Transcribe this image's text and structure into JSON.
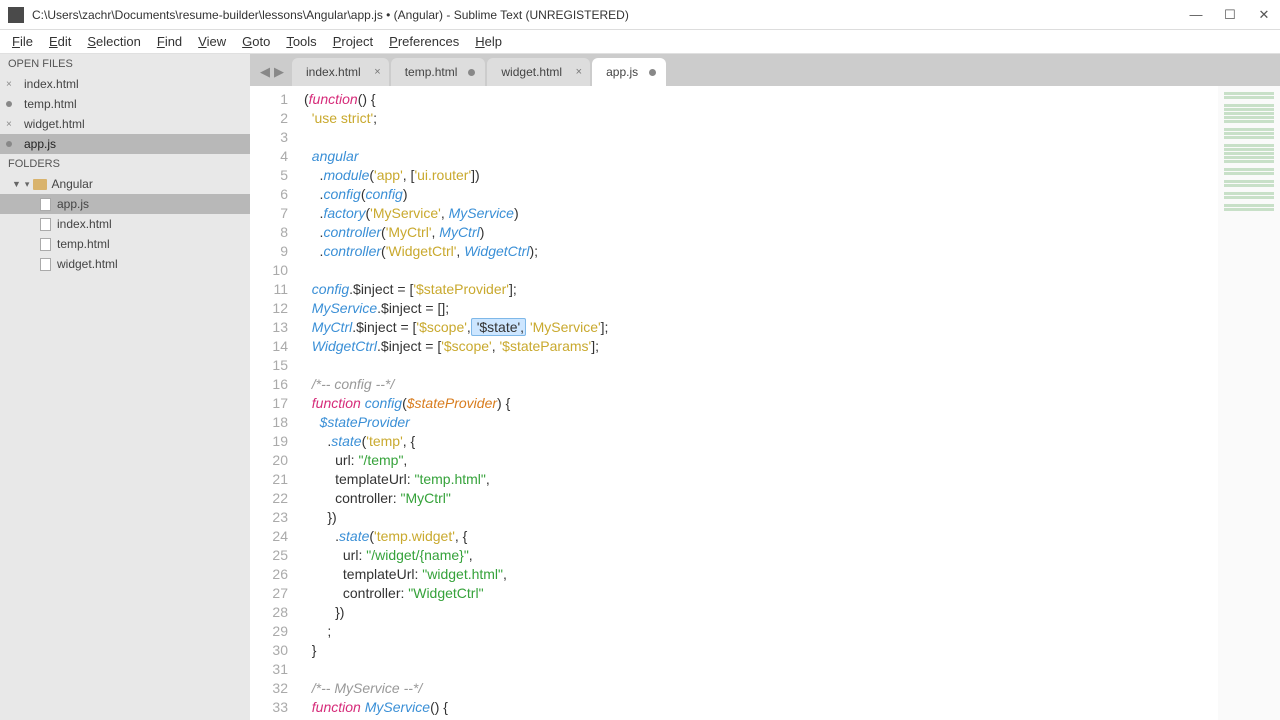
{
  "window": {
    "title": "C:\\Users\\zachr\\Documents\\resume-builder\\lessons\\Angular\\app.js • (Angular) - Sublime Text (UNREGISTERED)"
  },
  "menu": [
    "File",
    "Edit",
    "Selection",
    "Find",
    "View",
    "Goto",
    "Tools",
    "Project",
    "Preferences",
    "Help"
  ],
  "sidebar": {
    "open_files_label": "OPEN FILES",
    "open_files": [
      {
        "name": "index.html",
        "dirty": false
      },
      {
        "name": "temp.html",
        "dirty": true
      },
      {
        "name": "widget.html",
        "dirty": false
      },
      {
        "name": "app.js",
        "dirty": true,
        "active": true
      }
    ],
    "folders_label": "FOLDERS",
    "folder_name": "Angular",
    "files": [
      {
        "name": "app.js",
        "active": true
      },
      {
        "name": "index.html"
      },
      {
        "name": "temp.html"
      },
      {
        "name": "widget.html"
      }
    ]
  },
  "tabs": [
    {
      "label": "index.html",
      "dirty": false
    },
    {
      "label": "temp.html",
      "dirty": true
    },
    {
      "label": "widget.html",
      "dirty": false
    },
    {
      "label": "app.js",
      "dirty": true,
      "active": true
    }
  ],
  "code": {
    "lines": [
      [
        {
          "t": "("
        },
        {
          "t": "function",
          "c": "kw"
        },
        {
          "t": "() {"
        }
      ],
      [
        {
          "t": "  "
        },
        {
          "t": "'use strict'",
          "c": "str2"
        },
        {
          "t": ";"
        }
      ],
      [
        {
          "t": ""
        }
      ],
      [
        {
          "t": "  "
        },
        {
          "t": "angular",
          "c": "ent"
        }
      ],
      [
        {
          "t": "    ."
        },
        {
          "t": "module",
          "c": "fn"
        },
        {
          "t": "("
        },
        {
          "t": "'app'",
          "c": "str2"
        },
        {
          "t": ", ["
        },
        {
          "t": "'ui.router'",
          "c": "str2"
        },
        {
          "t": "])"
        }
      ],
      [
        {
          "t": "    ."
        },
        {
          "t": "config",
          "c": "fn"
        },
        {
          "t": "("
        },
        {
          "t": "config",
          "c": "ent"
        },
        {
          "t": ")"
        }
      ],
      [
        {
          "t": "    ."
        },
        {
          "t": "factory",
          "c": "fn"
        },
        {
          "t": "("
        },
        {
          "t": "'MyService'",
          "c": "str2"
        },
        {
          "t": ", "
        },
        {
          "t": "MyService",
          "c": "ent"
        },
        {
          "t": ")"
        }
      ],
      [
        {
          "t": "    ."
        },
        {
          "t": "controller",
          "c": "fn"
        },
        {
          "t": "("
        },
        {
          "t": "'MyCtrl'",
          "c": "str2"
        },
        {
          "t": ", "
        },
        {
          "t": "MyCtrl",
          "c": "ent"
        },
        {
          "t": ")"
        }
      ],
      [
        {
          "t": "    ."
        },
        {
          "t": "controller",
          "c": "fn"
        },
        {
          "t": "("
        },
        {
          "t": "'WidgetCtrl'",
          "c": "str2"
        },
        {
          "t": ", "
        },
        {
          "t": "WidgetCtrl",
          "c": "ent"
        },
        {
          "t": ");"
        }
      ],
      [
        {
          "t": ""
        }
      ],
      [
        {
          "t": "  "
        },
        {
          "t": "config",
          "c": "ent"
        },
        {
          "t": ".$inject = ["
        },
        {
          "t": "'$stateProvider'",
          "c": "str2"
        },
        {
          "t": "];"
        }
      ],
      [
        {
          "t": "  "
        },
        {
          "t": "MyService",
          "c": "ent"
        },
        {
          "t": ".$inject = [];"
        }
      ],
      [
        {
          "t": "  "
        },
        {
          "t": "MyCtrl",
          "c": "ent"
        },
        {
          "t": ".$inject = ["
        },
        {
          "t": "'$scope'",
          "c": "str2"
        },
        {
          "t": ","
        },
        {
          "t": " '$state',",
          "c": "sel"
        },
        {
          "t": " "
        },
        {
          "t": "'MyService'",
          "c": "str2"
        },
        {
          "t": "];"
        }
      ],
      [
        {
          "t": "  "
        },
        {
          "t": "WidgetCtrl",
          "c": "ent"
        },
        {
          "t": ".$inject = ["
        },
        {
          "t": "'$scope'",
          "c": "str2"
        },
        {
          "t": ", "
        },
        {
          "t": "'$stateParams'",
          "c": "str2"
        },
        {
          "t": "];"
        }
      ],
      [
        {
          "t": ""
        }
      ],
      [
        {
          "t": "  "
        },
        {
          "t": "/*-- config --*/",
          "c": "cm"
        }
      ],
      [
        {
          "t": "  "
        },
        {
          "t": "function",
          "c": "kw"
        },
        {
          "t": " "
        },
        {
          "t": "config",
          "c": "fn"
        },
        {
          "t": "("
        },
        {
          "t": "$stateProvider",
          "c": "par"
        },
        {
          "t": ") {"
        }
      ],
      [
        {
          "t": "    "
        },
        {
          "t": "$stateProvider",
          "c": "ent"
        }
      ],
      [
        {
          "t": "      ."
        },
        {
          "t": "state",
          "c": "fn"
        },
        {
          "t": "("
        },
        {
          "t": "'temp'",
          "c": "str2"
        },
        {
          "t": ", {"
        }
      ],
      [
        {
          "t": "        url: "
        },
        {
          "t": "\"/temp\"",
          "c": "str"
        },
        {
          "t": ","
        }
      ],
      [
        {
          "t": "        templateUrl: "
        },
        {
          "t": "\"temp.html\"",
          "c": "str"
        },
        {
          "t": ","
        }
      ],
      [
        {
          "t": "        controller: "
        },
        {
          "t": "\"MyCtrl\"",
          "c": "str"
        }
      ],
      [
        {
          "t": "      })"
        }
      ],
      [
        {
          "t": "        ."
        },
        {
          "t": "state",
          "c": "fn"
        },
        {
          "t": "("
        },
        {
          "t": "'temp.widget'",
          "c": "str2"
        },
        {
          "t": ", {"
        }
      ],
      [
        {
          "t": "          url: "
        },
        {
          "t": "\"/widget/{name}\"",
          "c": "str"
        },
        {
          "t": ","
        }
      ],
      [
        {
          "t": "          templateUrl: "
        },
        {
          "t": "\"widget.html\"",
          "c": "str"
        },
        {
          "t": ","
        }
      ],
      [
        {
          "t": "          controller: "
        },
        {
          "t": "\"WidgetCtrl\"",
          "c": "str"
        }
      ],
      [
        {
          "t": "        })"
        }
      ],
      [
        {
          "t": "      ;"
        }
      ],
      [
        {
          "t": "  }"
        }
      ],
      [
        {
          "t": ""
        }
      ],
      [
        {
          "t": "  "
        },
        {
          "t": "/*-- MyService --*/",
          "c": "cm"
        }
      ],
      [
        {
          "t": "  "
        },
        {
          "t": "function",
          "c": "kw"
        },
        {
          "t": " "
        },
        {
          "t": "MyService",
          "c": "fn"
        },
        {
          "t": "() {"
        }
      ]
    ],
    "first_line_number": 1
  }
}
